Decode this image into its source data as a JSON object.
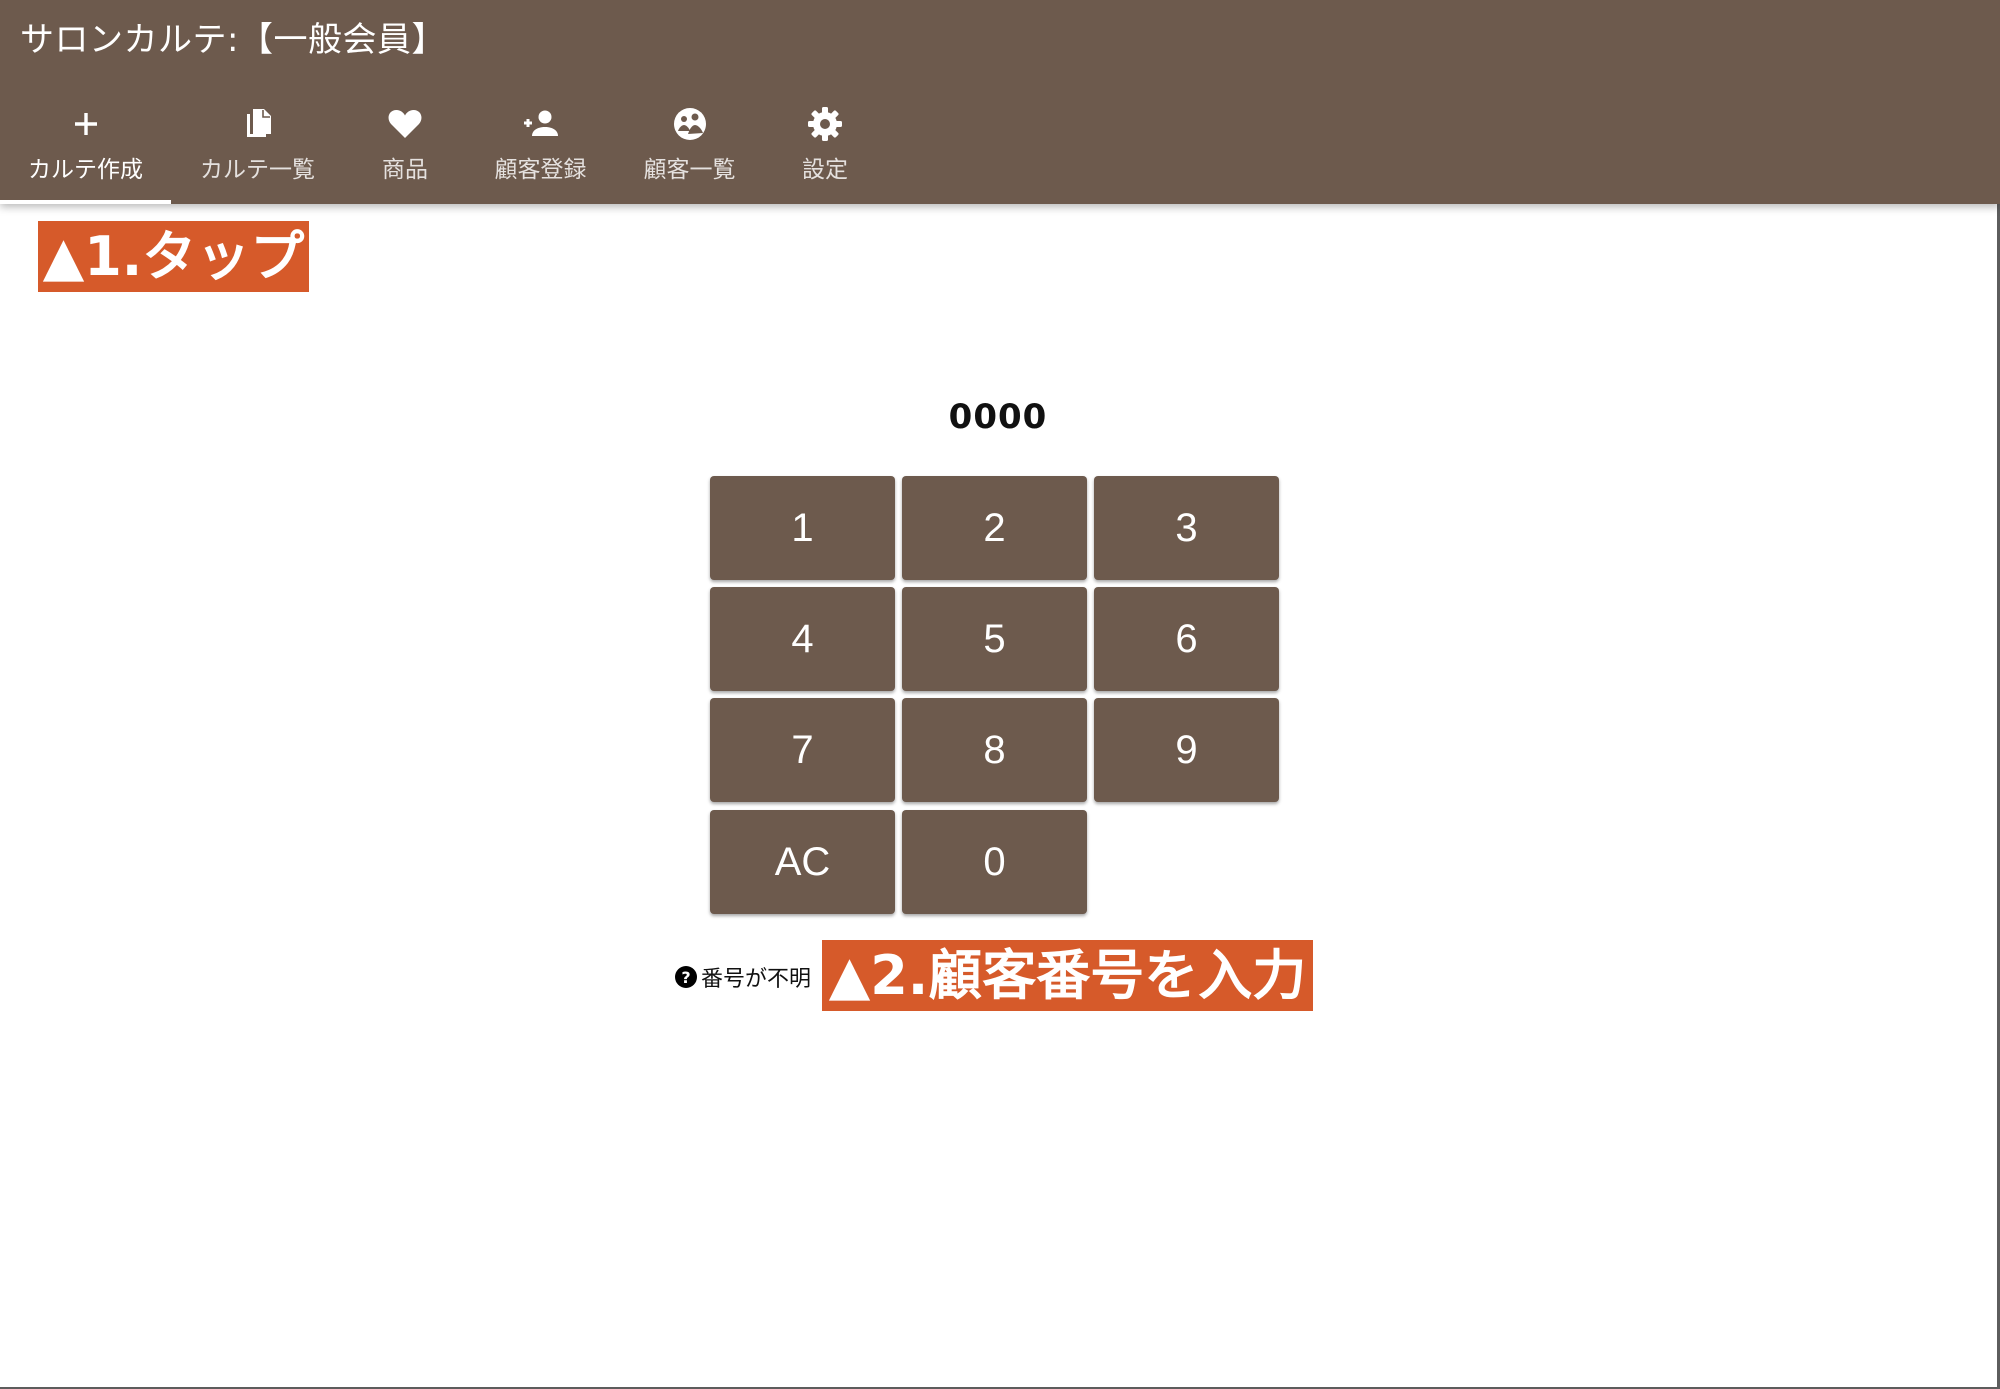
{
  "header": {
    "app_title": "サロンカルテ:【一般会員】",
    "background_color": "#6d5a4d"
  },
  "tabs": [
    {
      "label": "カルテ作成",
      "icon": "plus-icon",
      "active": true
    },
    {
      "label": "カルテ一覧",
      "icon": "copy-document-icon",
      "active": false
    },
    {
      "label": "商品",
      "icon": "heart-icon",
      "active": false
    },
    {
      "label": "顧客登録",
      "icon": "person-add-icon",
      "active": false
    },
    {
      "label": "顧客一覧",
      "icon": "group-icon",
      "active": false
    },
    {
      "label": "設定",
      "icon": "gear-icon",
      "active": false
    }
  ],
  "keypad": {
    "display_value": "0000",
    "keys": [
      "1",
      "2",
      "3",
      "4",
      "5",
      "6",
      "7",
      "8",
      "9",
      "AC",
      "0"
    ]
  },
  "help": {
    "icon": "question-circle-icon",
    "text": "番号が不明"
  },
  "annotations": {
    "step1": "▲1.タップ",
    "step2": "▲2.顧客番号を入力",
    "color": "#d65a2a"
  }
}
